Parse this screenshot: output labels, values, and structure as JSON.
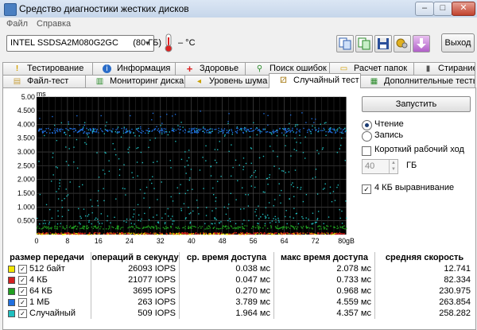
{
  "window": {
    "title": "Средство диагностики жестких дисков",
    "buttons": {
      "minimize": "–",
      "maximize": "□",
      "close": "✕"
    }
  },
  "menu": {
    "file": "Файл",
    "help": "Справка"
  },
  "toolbar": {
    "drive": "INTEL SSDSA2M080G2GC      (80 ГБ)",
    "temperature": "– °C",
    "exit_label": "Выход",
    "icons": [
      "copy-icon",
      "copy-green-icon",
      "save-icon",
      "settings-icon",
      "download-icon"
    ]
  },
  "tabs_row1": [
    {
      "label": "Тестирование",
      "icon": "!"
    },
    {
      "label": "Информация",
      "icon": "i"
    },
    {
      "label": "Здоровье",
      "icon": "+"
    },
    {
      "label": "Поиск ошибок",
      "icon": "⚲"
    },
    {
      "label": "Расчет папок",
      "icon": "▭"
    },
    {
      "label": "Стирание",
      "icon": "▮"
    }
  ],
  "tabs_row2": [
    {
      "label": "Файл-тест",
      "icon": "▤"
    },
    {
      "label": "Мониторинг диска",
      "icon": "▥"
    },
    {
      "label": "Уровень шума",
      "icon": "◂"
    },
    {
      "label": "Случайный тест",
      "icon": "⚂",
      "active": true
    },
    {
      "label": "Дополнительные тесты",
      "icon": "▦"
    }
  ],
  "side": {
    "start_label": "Запустить",
    "read_label": "Чтение",
    "write_label": "Запись",
    "short_stroke_label": "Короткий рабочий ход",
    "short_stroke_value": "40",
    "short_stroke_unit": "ГБ",
    "align_label": "4 КБ выравнивание",
    "read_selected": true,
    "align_checked": true,
    "short_stroke_checked": false
  },
  "table": {
    "headers": [
      "размер передачи",
      "операций в секунду",
      "ср. время доступа",
      "макс время доступа",
      "средняя скорость"
    ],
    "rows": [
      {
        "label": "512 байт",
        "color": "#f2e600",
        "iops": "26093 IOPS",
        "avg": "0.038 мс",
        "max": "2.078 мс",
        "speed": "12.741"
      },
      {
        "label": "4 КБ",
        "color": "#d42020",
        "iops": "21077 IOPS",
        "avg": "0.047 мс",
        "max": "0.733 мс",
        "speed": "82.334"
      },
      {
        "label": "64 КБ",
        "color": "#20a020",
        "iops": "3695 IOPS",
        "avg": "0.270 мс",
        "max": "0.968 мс",
        "speed": "230.975"
      },
      {
        "label": "1 МБ",
        "color": "#2070e0",
        "iops": "263 IOPS",
        "avg": "3.789 мс",
        "max": "4.559 мс",
        "speed": "263.854"
      },
      {
        "label": "Случайный",
        "color": "#20c0c0",
        "iops": "509 IOPS",
        "avg": "1.964 мс",
        "max": "4.357 мс",
        "speed": "258.282"
      }
    ]
  },
  "chart_data": {
    "type": "scatter",
    "ylabel": "ms",
    "xlabel_unit": "gB",
    "ylim": [
      0,
      5
    ],
    "xlim": [
      0,
      80
    ],
    "y_ticks": [
      "5.00",
      "4.500",
      "4.000",
      "3.500",
      "3.000",
      "2.500",
      "2.000",
      "1.500",
      "1.000",
      "0.500"
    ],
    "x_ticks": [
      "0",
      "8",
      "16",
      "24",
      "32",
      "40",
      "48",
      "56",
      "64",
      "72",
      "80gB"
    ],
    "background": "#000000",
    "grid": true,
    "series": [
      {
        "name": "512 байт",
        "color": "#f2e600",
        "typical_ms": 0.04
      },
      {
        "name": "4 КБ",
        "color": "#d42020",
        "typical_ms": 0.05
      },
      {
        "name": "64 КБ",
        "color": "#20a020",
        "typical_ms": 0.27
      },
      {
        "name": "1 МБ",
        "color": "#2070e0",
        "typical_ms": 3.79
      },
      {
        "name": "Случайный",
        "color": "#20c0c0",
        "typical_ms": 1.96
      }
    ]
  }
}
